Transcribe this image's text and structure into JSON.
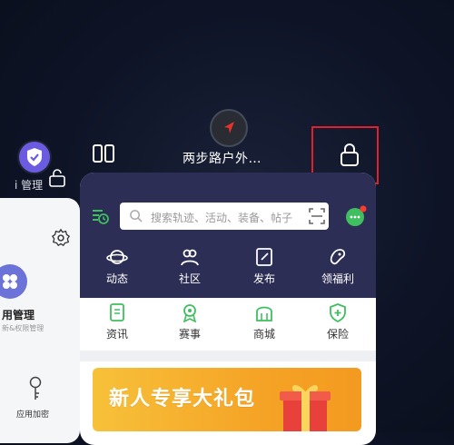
{
  "recents": {
    "left_app_label": "i 管理",
    "current_app_title": "两步路户外…"
  },
  "left_card": {
    "title": "用管理",
    "subtitle": "新&权限管理",
    "bottom_label": "应用加密"
  },
  "app": {
    "search_placeholder": "搜索轨迹、活动、装备、帖子",
    "nav": [
      {
        "label": "动态",
        "icon": "planet-icon"
      },
      {
        "label": "社区",
        "icon": "community-icon"
      },
      {
        "label": "发布",
        "icon": "edit-icon"
      },
      {
        "label": "领福利",
        "icon": "bean-icon"
      }
    ],
    "sub_nav": [
      {
        "label": "资讯",
        "icon": "news-icon"
      },
      {
        "label": "赛事",
        "icon": "medal-icon"
      },
      {
        "label": "商城",
        "icon": "mall-icon"
      },
      {
        "label": "保险",
        "icon": "shield-plus-icon"
      }
    ],
    "banner_text": "新人专享大礼包"
  },
  "colors": {
    "hero_bg": "#2d2e55",
    "accent_green": "#3fbf5f",
    "lock_highlight": "#e0202a",
    "banner_orange": "#f5a426"
  }
}
